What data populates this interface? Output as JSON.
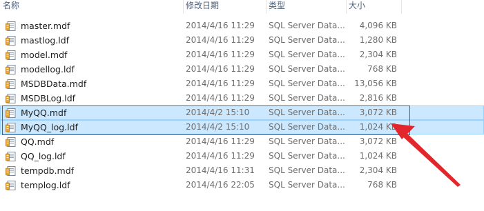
{
  "columns": {
    "name": "名称",
    "date": "修改日期",
    "type": "类型",
    "size": "大小"
  },
  "files": [
    {
      "name": "master.mdf",
      "date": "2014/4/16 11:29",
      "type": "SQL Server Data...",
      "size": "4,096 KB",
      "selected": false
    },
    {
      "name": "mastlog.ldf",
      "date": "2014/4/16 11:29",
      "type": "SQL Server Data...",
      "size": "1,280 KB",
      "selected": false
    },
    {
      "name": "model.mdf",
      "date": "2014/4/16 11:29",
      "type": "SQL Server Data...",
      "size": "2,304 KB",
      "selected": false
    },
    {
      "name": "modellog.ldf",
      "date": "2014/4/16 11:29",
      "type": "SQL Server Data...",
      "size": "768 KB",
      "selected": false
    },
    {
      "name": "MSDBData.mdf",
      "date": "2014/4/16 11:29",
      "type": "SQL Server Data...",
      "size": "13,056 KB",
      "selected": false
    },
    {
      "name": "MSDBLog.ldf",
      "date": "2014/4/16 11:29",
      "type": "SQL Server Data...",
      "size": "2,816 KB",
      "selected": false
    },
    {
      "name": "MyQQ.mdf",
      "date": "2014/4/2 15:10",
      "type": "SQL Server Data...",
      "size": "3,072 KB",
      "selected": true
    },
    {
      "name": "MyQQ_log.ldf",
      "date": "2014/4/2 15:10",
      "type": "SQL Server Data...",
      "size": "1,024 KB",
      "selected": true
    },
    {
      "name": "QQ.mdf",
      "date": "2014/4/16 11:29",
      "type": "SQL Server Data...",
      "size": "3,072 KB",
      "selected": false
    },
    {
      "name": "QQ_log.ldf",
      "date": "2014/4/16 11:29",
      "type": "SQL Server Data...",
      "size": "1,024 KB",
      "selected": false
    },
    {
      "name": "tempdb.mdf",
      "date": "2014/4/16 11:31",
      "type": "SQL Server Data...",
      "size": "2,304 KB",
      "selected": false
    },
    {
      "name": "templog.ldf",
      "date": "2014/4/16 22:05",
      "type": "SQL Server Data...",
      "size": "768 KB",
      "selected": false
    }
  ],
  "icon": "sql-data-file-icon",
  "colors": {
    "selection_bg": "#cce8ff",
    "selection_border": "#99d1ff",
    "annotation_red": "#d7282f",
    "header_text": "#4c607a"
  }
}
